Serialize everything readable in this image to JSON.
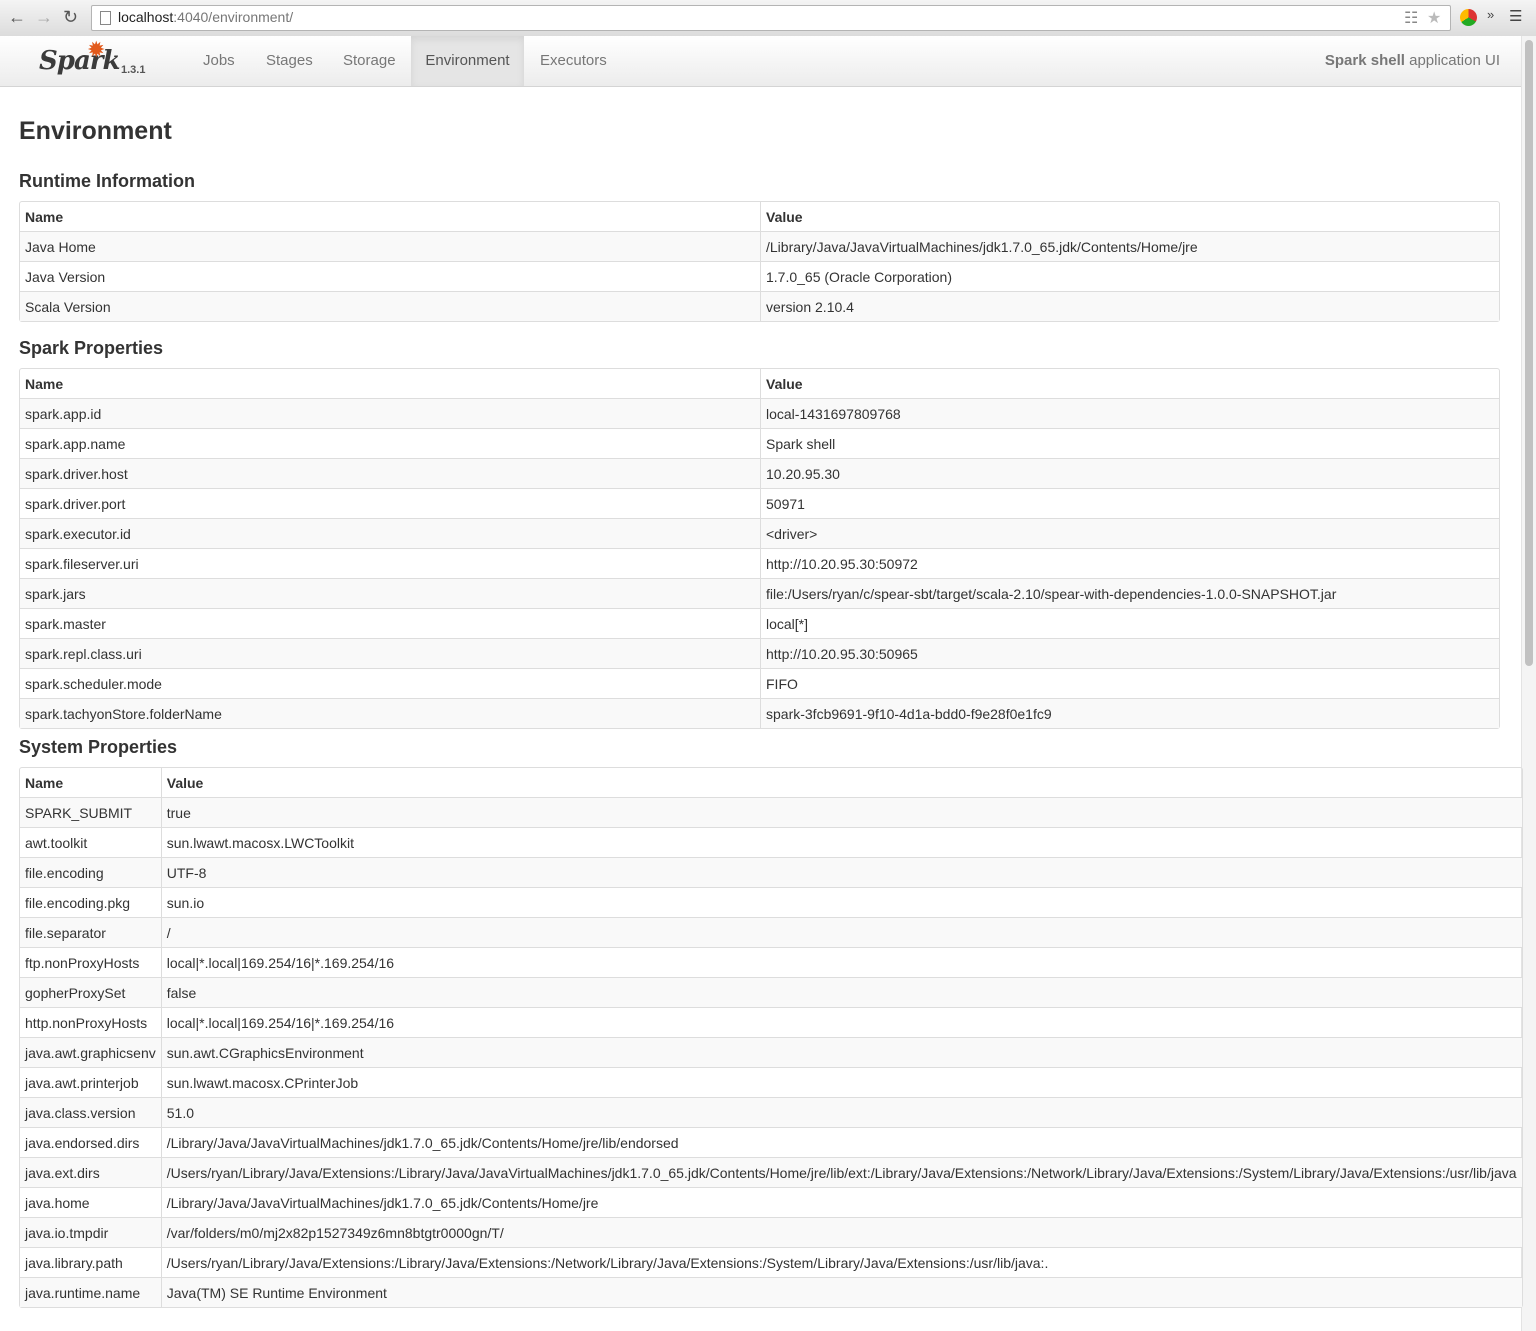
{
  "browser": {
    "url_host": "localhost",
    "url_path": ":4040/environment/"
  },
  "navbar": {
    "logo_text": "Spark",
    "version": "1.3.1",
    "tabs": [
      {
        "label": "Jobs",
        "active": false
      },
      {
        "label": "Stages",
        "active": false
      },
      {
        "label": "Storage",
        "active": false
      },
      {
        "label": "Environment",
        "active": true
      },
      {
        "label": "Executors",
        "active": false
      }
    ],
    "app_name": "Spark shell",
    "app_suffix": " application UI"
  },
  "page": {
    "title": "Environment"
  },
  "runtime": {
    "heading": "Runtime Information",
    "col_name": "Name",
    "col_value": "Value",
    "rows": [
      [
        "Java Home",
        "/Library/Java/JavaVirtualMachines/jdk1.7.0_65.jdk/Contents/Home/jre"
      ],
      [
        "Java Version",
        "1.7.0_65 (Oracle Corporation)"
      ],
      [
        "Scala Version",
        "version 2.10.4"
      ]
    ]
  },
  "spark": {
    "heading": "Spark Properties",
    "col_name": "Name",
    "col_value": "Value",
    "rows": [
      [
        "spark.app.id",
        "local-1431697809768"
      ],
      [
        "spark.app.name",
        "Spark shell"
      ],
      [
        "spark.driver.host",
        "10.20.95.30"
      ],
      [
        "spark.driver.port",
        "50971"
      ],
      [
        "spark.executor.id",
        "<driver>"
      ],
      [
        "spark.fileserver.uri",
        "http://10.20.95.30:50972"
      ],
      [
        "spark.jars",
        "file:/Users/ryan/c/spear-sbt/target/scala-2.10/spear-with-dependencies-1.0.0-SNAPSHOT.jar"
      ],
      [
        "spark.master",
        "local[*]"
      ],
      [
        "spark.repl.class.uri",
        "http://10.20.95.30:50965"
      ],
      [
        "spark.scheduler.mode",
        "FIFO"
      ],
      [
        "spark.tachyonStore.folderName",
        "spark-3fcb9691-9f10-4d1a-bdd0-f9e28f0e1fc9"
      ]
    ]
  },
  "system": {
    "heading": "System Properties",
    "col_name": "Name",
    "col_value": "Value",
    "rows": [
      [
        "SPARK_SUBMIT",
        "true"
      ],
      [
        "awt.toolkit",
        "sun.lwawt.macosx.LWCToolkit"
      ],
      [
        "file.encoding",
        "UTF-8"
      ],
      [
        "file.encoding.pkg",
        "sun.io"
      ],
      [
        "file.separator",
        "/"
      ],
      [
        "ftp.nonProxyHosts",
        "local|*.local|169.254/16|*.169.254/16"
      ],
      [
        "gopherProxySet",
        "false"
      ],
      [
        "http.nonProxyHosts",
        "local|*.local|169.254/16|*.169.254/16"
      ],
      [
        "java.awt.graphicsenv",
        "sun.awt.CGraphicsEnvironment"
      ],
      [
        "java.awt.printerjob",
        "sun.lwawt.macosx.CPrinterJob"
      ],
      [
        "java.class.version",
        "51.0"
      ],
      [
        "java.endorsed.dirs",
        "/Library/Java/JavaVirtualMachines/jdk1.7.0_65.jdk/Contents/Home/jre/lib/endorsed"
      ],
      [
        "java.ext.dirs",
        "/Users/ryan/Library/Java/Extensions:/Library/Java/JavaVirtualMachines/jdk1.7.0_65.jdk/Contents/Home/jre/lib/ext:/Library/Java/Extensions:/Network/Library/Java/Extensions:/System/Library/Java/Extensions:/usr/lib/java"
      ],
      [
        "java.home",
        "/Library/Java/JavaVirtualMachines/jdk1.7.0_65.jdk/Contents/Home/jre"
      ],
      [
        "java.io.tmpdir",
        "/var/folders/m0/mj2x82p1527349z6mn8btgtr0000gn/T/"
      ],
      [
        "java.library.path",
        "/Users/ryan/Library/Java/Extensions:/Library/Java/Extensions:/Network/Library/Java/Extensions:/System/Library/Java/Extensions:/usr/lib/java:."
      ],
      [
        "java.runtime.name",
        "Java(TM) SE Runtime Environment"
      ]
    ]
  }
}
